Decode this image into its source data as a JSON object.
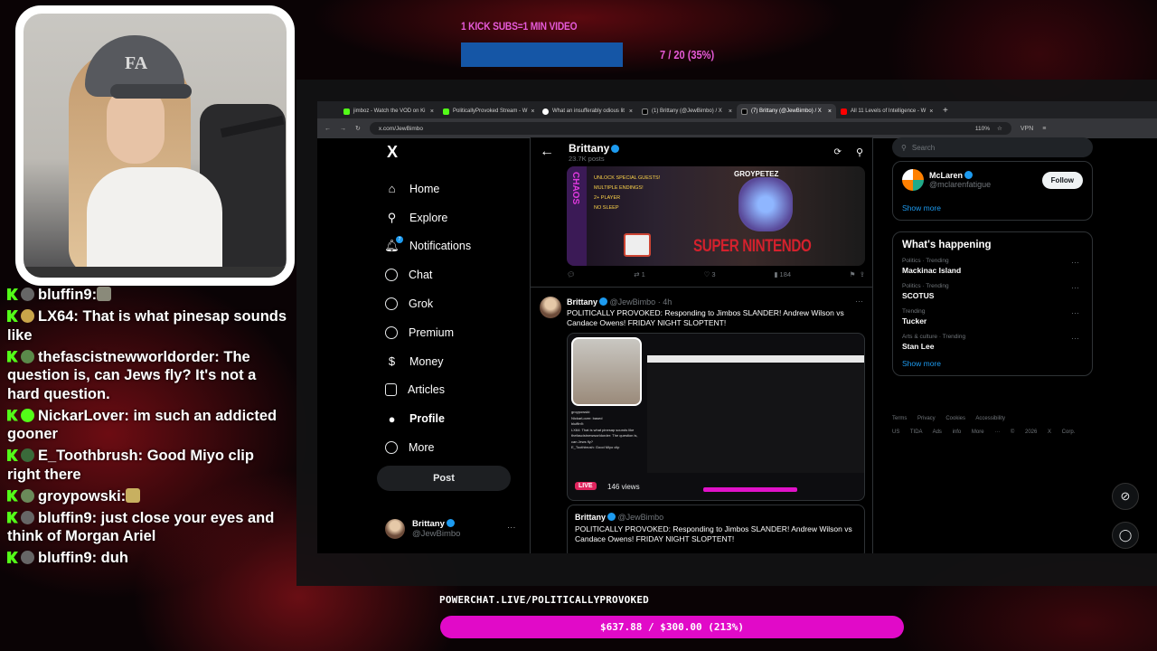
{
  "goals": {
    "subs_title": "1 KICK SUBS=1 MIN VIDEO",
    "subs_count": "7 / 20 (35%)",
    "subs_progress": 0.35,
    "powerchat_label": "POWERCHAT.LIVE/POLITICALLYPROVOKED",
    "powerchat_amount": "$637.88 / $300.00 (213%)",
    "pink": "#e10ac8",
    "blue": "#1556a6"
  },
  "chat": [
    {
      "user": "bluffin9:",
      "text": ""
    },
    {
      "user": "LX64:",
      "text": " That is what pinesap sounds like"
    },
    {
      "user": "thefascistnewworldorder:",
      "text": " The question is, can Jews fly? It's not a hard question."
    },
    {
      "user": "NickarLover:",
      "text": " im such an addicted gooner"
    },
    {
      "user": "E_Toothbrush:",
      "text": " Good Miyo clip right there"
    },
    {
      "user": "groypowski:",
      "text": ""
    },
    {
      "user": "bluffin9:",
      "text": " just close your eyes and think of Morgan Ariel"
    },
    {
      "user": "bluffin9:",
      "text": " duh"
    }
  ],
  "browser": {
    "tabs": [
      {
        "label": "jimboz - Watch the VOD on Ki"
      },
      {
        "label": "PoliticallyProvoked Stream - W"
      },
      {
        "label": "What an insufferably odious lit"
      },
      {
        "label": "(1) Brittany (@JewBimbo) / X"
      },
      {
        "label": "(7) Brittany (@JewBimbo) / X",
        "active": true
      },
      {
        "label": "All 11 Levels of Intelligence - W"
      }
    ],
    "url": "x.com/JewBimbo",
    "zoom": "110%",
    "vpn": "VPN"
  },
  "nav": {
    "logo": "X",
    "items": [
      "Home",
      "Explore",
      "Notifications",
      "Chat",
      "Grok",
      "Premium",
      "Money",
      "Articles",
      "Profile",
      "More"
    ],
    "notif_badge": "7",
    "post_label": "Post",
    "me_name": "Brittany",
    "me_handle": "@JewBimbo"
  },
  "profile": {
    "name": "Brittany",
    "posts": "23.7K posts"
  },
  "tweet1": {
    "snes": "SUPER NINTENDO",
    "side": "CHAOS",
    "list": [
      "UNLOCK SPECIAL GUESTS!",
      "MULTIPLE ENDINGS!",
      "2+ PLAYER",
      "NO SLEEP"
    ],
    "brand": "GROYPETEZ",
    "retweets": "1",
    "likes": "3",
    "views": "184"
  },
  "tweet2": {
    "name": "Brittany",
    "handle": "@JewBimbo",
    "time": "· 4h",
    "text": "POLITICALLY PROVOKED: Responding to Jimbos SLANDER! Andrew Wilson vs Candace Owens! FRIDAY NIGHT SLOPTENT!",
    "live": "LIVE",
    "views": "146 views",
    "quote_name": "Brittany",
    "quote_handle": "@JewBimbo",
    "quote_text": "POLITICALLY PROVOKED: Responding to Jimbos SLANDER! Andrew Wilson vs Candace Owens! FRIDAY NIGHT SLOPTENT!"
  },
  "right": {
    "search_placeholder": "Search",
    "follow_name": "McLaren",
    "follow_handle": "@mclarenfatigue",
    "follow_btn": "Follow",
    "show_more": "Show more",
    "happening_title": "What's happening",
    "trends": [
      {
        "cat": "Politics · Trending",
        "name": "Mackinac Island"
      },
      {
        "cat": "Politics · Trending",
        "name": "SCOTUS"
      },
      {
        "cat": "Trending",
        "name": "Tucker"
      },
      {
        "cat": "Arts & culture · Trending",
        "name": "Stan Lee"
      }
    ],
    "show_more2": "Show more",
    "footer1": "Terms Privacy Cookies Accessibility",
    "footer2": "US TIDA Ads info More ··· © 2026 X Corp."
  }
}
